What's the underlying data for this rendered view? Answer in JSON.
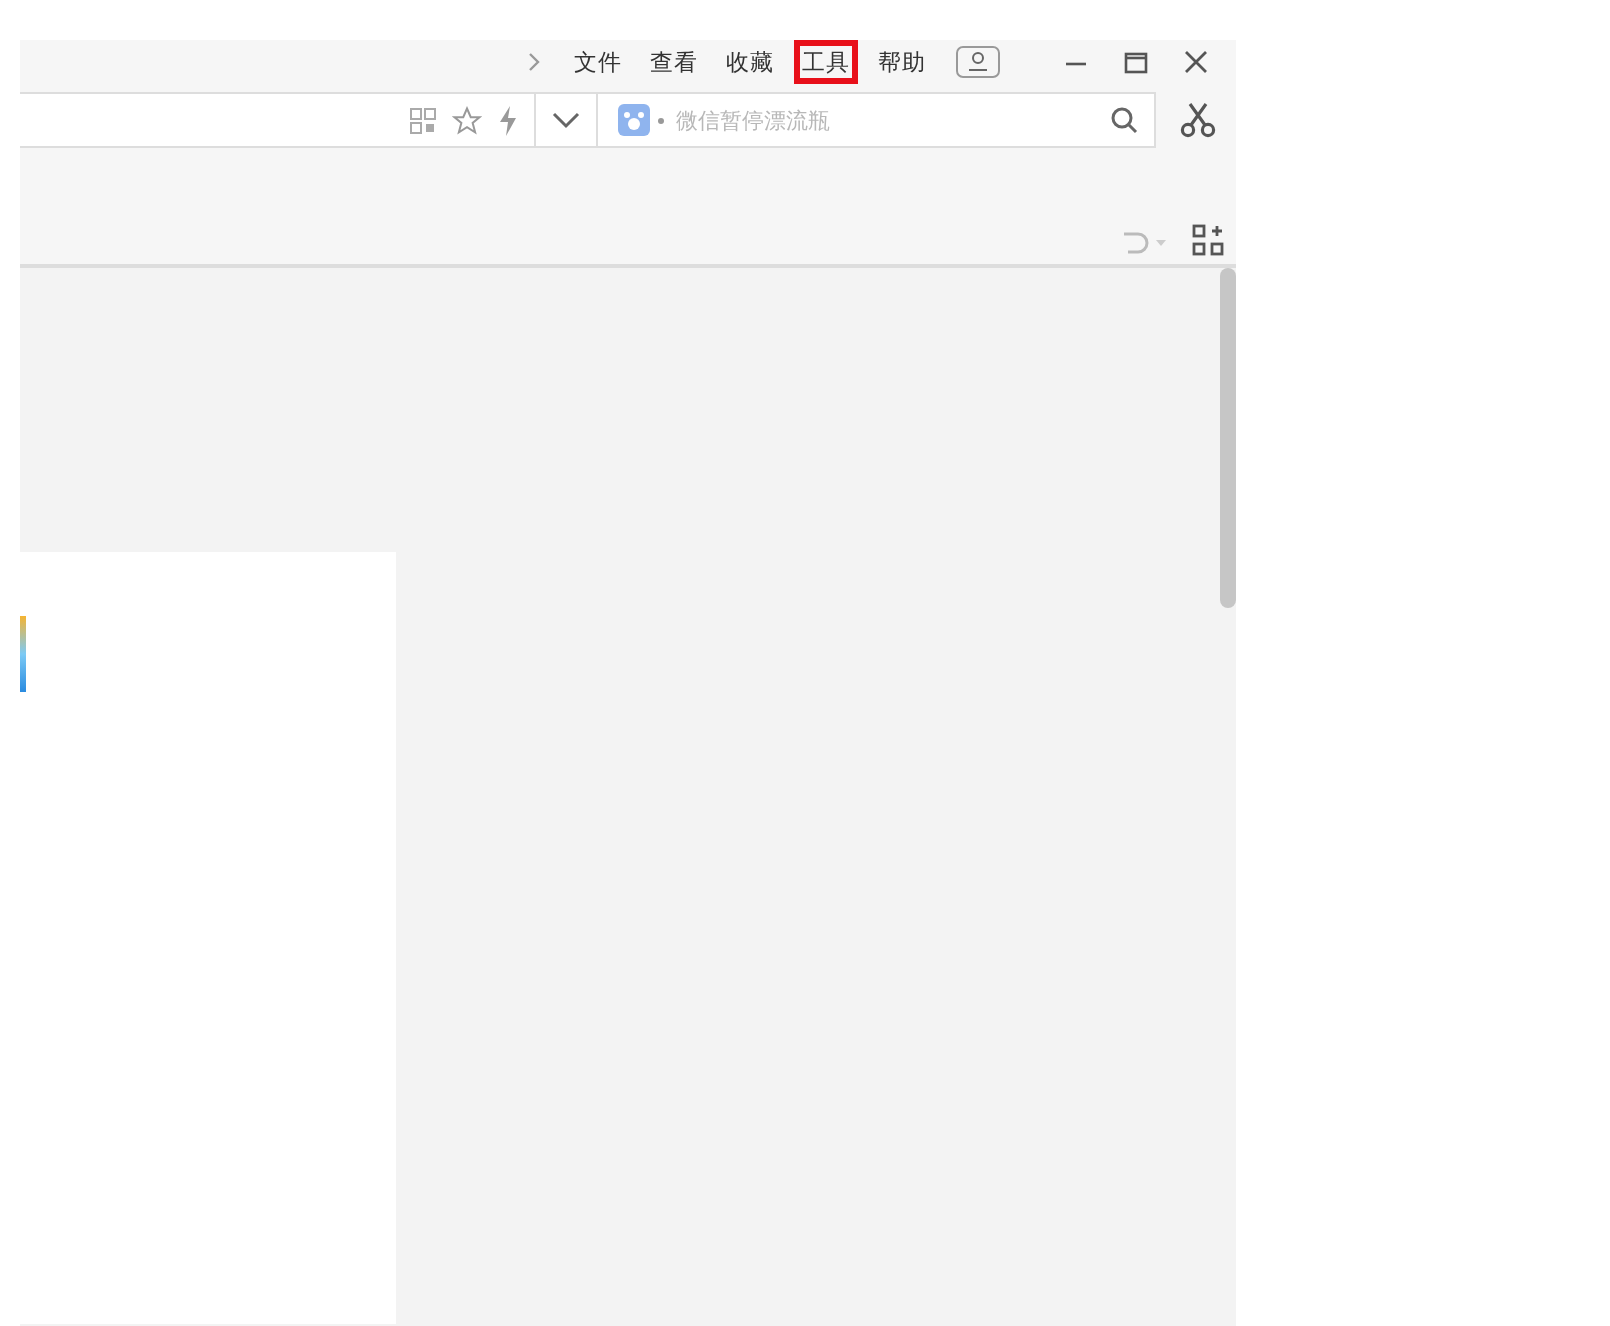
{
  "menu": {
    "items": [
      {
        "label": "文件",
        "selected": false
      },
      {
        "label": "查看",
        "selected": false
      },
      {
        "label": "收藏",
        "selected": false
      },
      {
        "label": "工具",
        "selected": true
      },
      {
        "label": "帮助",
        "selected": false
      }
    ]
  },
  "search": {
    "placeholder": "微信暂停漂流瓶"
  }
}
